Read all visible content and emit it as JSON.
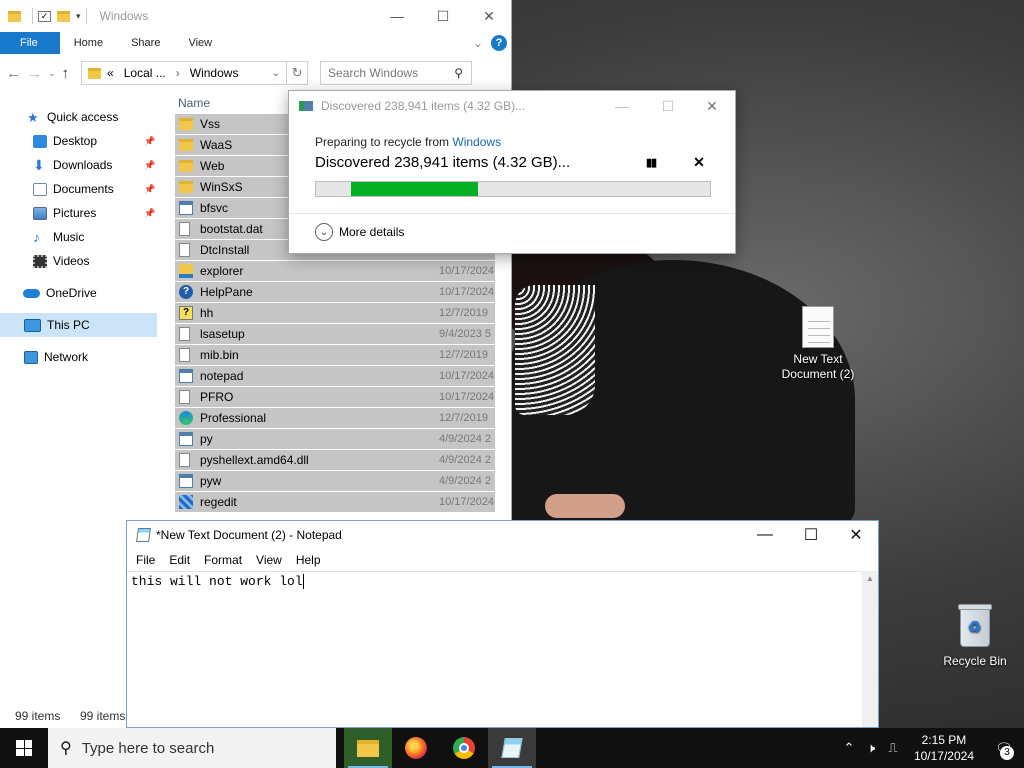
{
  "desktop": {
    "icons": [
      {
        "label": "New Text Document (2)",
        "icon": "text-file-icon"
      },
      {
        "label": "Recycle Bin",
        "icon": "recycle-bin-icon"
      }
    ]
  },
  "explorer": {
    "title": "Windows",
    "ribbon_tabs": [
      "File",
      "Home",
      "Share",
      "View"
    ],
    "address": {
      "prefix": "«",
      "crumbs": [
        "Local ...",
        "Windows"
      ]
    },
    "search_placeholder": "Search Windows",
    "nav": [
      {
        "label": "Quick access",
        "pinned": false
      },
      {
        "label": "Desktop",
        "pinned": true
      },
      {
        "label": "Downloads",
        "pinned": true
      },
      {
        "label": "Documents",
        "pinned": true
      },
      {
        "label": "Pictures",
        "pinned": true
      },
      {
        "label": "Music",
        "pinned": false
      },
      {
        "label": "Videos",
        "pinned": false
      },
      {
        "label": "OneDrive",
        "pinned": false
      },
      {
        "label": "This PC",
        "pinned": false,
        "selected": true
      },
      {
        "label": "Network",
        "pinned": false
      }
    ],
    "column_name": "Name",
    "files": [
      {
        "name": "Vss",
        "date": "",
        "icon": "folder"
      },
      {
        "name": "WaaS",
        "date": "",
        "icon": "folder"
      },
      {
        "name": "Web",
        "date": "",
        "icon": "folder"
      },
      {
        "name": "WinSxS",
        "date": "",
        "icon": "folder"
      },
      {
        "name": "bfsvc",
        "date": "",
        "icon": "app"
      },
      {
        "name": "bootstat.dat",
        "date": "",
        "icon": "file"
      },
      {
        "name": "DtcInstall",
        "date": "10/17/2024",
        "icon": "file"
      },
      {
        "name": "explorer",
        "date": "10/17/2024",
        "icon": "explorer"
      },
      {
        "name": "HelpPane",
        "date": "10/17/2024",
        "icon": "help"
      },
      {
        "name": "hh",
        "date": "12/7/2019",
        "icon": "hh"
      },
      {
        "name": "lsasetup",
        "date": "9/4/2023 5",
        "icon": "file"
      },
      {
        "name": "mib.bin",
        "date": "12/7/2019",
        "icon": "file"
      },
      {
        "name": "notepad",
        "date": "10/17/2024",
        "icon": "app"
      },
      {
        "name": "PFRO",
        "date": "10/17/2024",
        "icon": "file"
      },
      {
        "name": "Professional",
        "date": "12/7/2019",
        "icon": "edge"
      },
      {
        "name": "py",
        "date": "4/9/2024 2",
        "icon": "app"
      },
      {
        "name": "pyshellext.amd64.dll",
        "date": "4/9/2024 2",
        "icon": "file"
      },
      {
        "name": "pyw",
        "date": "4/9/2024 2",
        "icon": "app"
      },
      {
        "name": "regedit",
        "date": "10/17/2024",
        "icon": "reg"
      }
    ],
    "status_left": "99 items",
    "status_right": "99 items"
  },
  "progress_dialog": {
    "title": "Discovered 238,941 items (4.32 GB)...",
    "from_prefix": "Preparing to recycle from ",
    "from_link": "Windows",
    "main_text": "Discovered 238,941 items (4.32 GB)...",
    "progress_start": 0.09,
    "progress_end": 0.41,
    "progress_color": "#06b025",
    "more_details": "More details"
  },
  "notepad": {
    "title": "*New Text Document (2) - Notepad",
    "menu": [
      "File",
      "Edit",
      "Format",
      "View",
      "Help"
    ],
    "content": "this will not work lol"
  },
  "taskbar": {
    "search_placeholder": "Type here to search",
    "apps": [
      "file-explorer-icon",
      "firefox-icon",
      "chrome-icon",
      "notepad-icon"
    ],
    "time": "2:15 PM",
    "date": "10/17/2024",
    "notification_count": "3"
  }
}
